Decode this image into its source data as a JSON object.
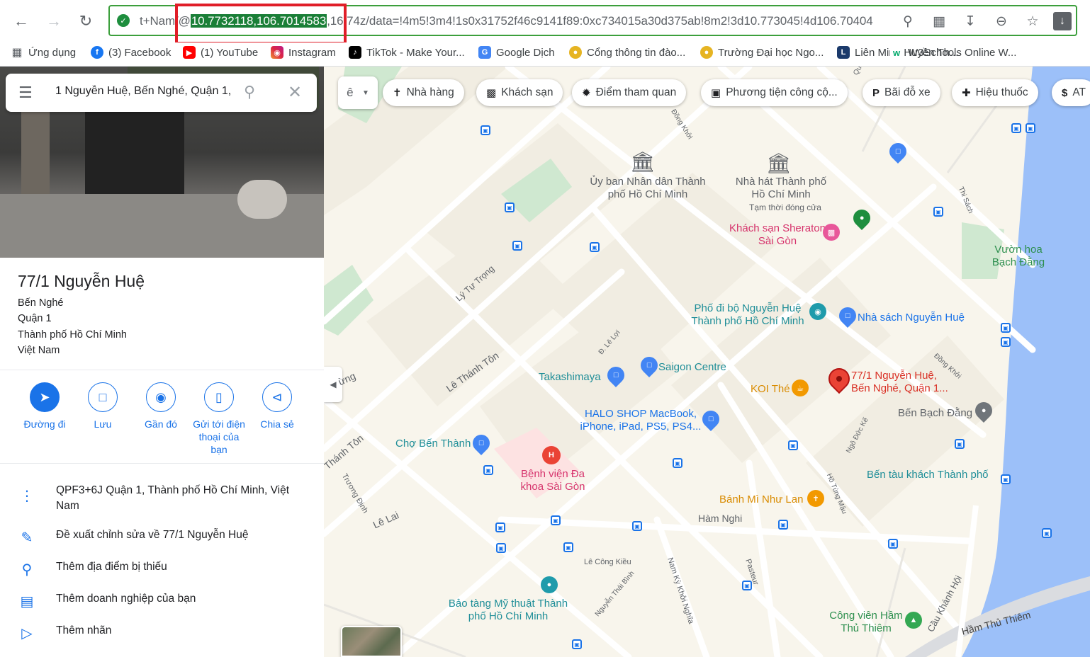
{
  "browser": {
    "url_prefix": "t+Nam/@",
    "url_highlight": "10.7732118,106.7014583",
    "url_suffix": ",16.74z/data=!4m5!3m4!1s0x31752f46c9141f89:0xc734015a30d375ab!8m2!3d10.773045!4d106.70404"
  },
  "bookmarks": [
    {
      "label": "Ứng dụng"
    },
    {
      "label": "(3) Facebook"
    },
    {
      "label": "(1) YouTube"
    },
    {
      "label": "Instagram"
    },
    {
      "label": "TikTok - Make Your..."
    },
    {
      "label": "Google Dịch"
    },
    {
      "label": "Cổng thông tin đào..."
    },
    {
      "label": "Trường Đại học Ngo..."
    },
    {
      "label": "Liên Minh Huyền Th..."
    },
    {
      "label": "W3Schools Online W..."
    }
  ],
  "search": {
    "value": "1 Nguyễn Huệ, Bến Nghé, Quận 1,"
  },
  "place": {
    "title": "77/1 Nguyễn Huệ",
    "address": [
      "Bến Nghé",
      "Quận 1",
      "Thành phố Hồ Chí Minh",
      "Việt Nam"
    ]
  },
  "actions": [
    {
      "label": "Đường đi"
    },
    {
      "label": "Lưu"
    },
    {
      "label": "Gần đó"
    },
    {
      "label": "Gửi tới điện thoại của bạn"
    },
    {
      "label": "Chia sẻ"
    }
  ],
  "info_rows": [
    {
      "text": "QPF3+6J Quận 1, Thành phố Hồ Chí Minh, Việt Nam"
    },
    {
      "text": "Đề xuất chỉnh sửa về 77/1 Nguyễn Huệ"
    },
    {
      "text": "Thêm địa điểm bị thiếu"
    },
    {
      "text": "Thêm doanh nghiệp của bạn"
    },
    {
      "text": "Thêm nhãn"
    }
  ],
  "map": {
    "lang_glyph": "ê",
    "chips": [
      {
        "label": "Nhà hàng"
      },
      {
        "label": "Khách sạn"
      },
      {
        "label": "Điểm tham quan"
      },
      {
        "label": "Phương tiện công cộ..."
      },
      {
        "label": "Bãi đỗ xe"
      },
      {
        "label": "Hiệu thuốc"
      },
      {
        "label": "AT"
      }
    ],
    "places": {
      "ubnd": "Ủy ban Nhân dân Thành phố Hồ Chí Minh",
      "nhahat": "Nhà hát Thành phố Hồ Chí Minh",
      "nhahat_sub": "Tạm thời đóng cửa",
      "sheraton": "Khách sạn Sheraton Sài Gòn",
      "vuonhoa": "Vườn hoa Bạch Đằng",
      "phodibo": "Phố đi bộ Nguyễn Huệ Thành phố Hồ Chí Minh",
      "nhasach": "Nhà sách Nguyễn Huệ",
      "takashimaya": "Takashimaya",
      "saigoncentre": "Saigon Centre",
      "koi": "KOI Thé",
      "pin_label": "77/1 Nguyễn Huệ, Bến Nghé, Quận 1...",
      "halo": "HALO SHOP MacBook, iPhone, iPad, PS5, PS4...",
      "benbachdang": "Bến Bạch Đằng",
      "chobenthanh": "Chợ Bến Thành",
      "benhvien": "Bệnh viện Đa khoa Sài Gòn",
      "bentau": "Bến tàu khách Thành phố",
      "banhmi": "Bánh Mì Như Lan",
      "baotang": "Bảo tàng Mỹ thuật Thành phố Hồ Chí Minh",
      "congvien": "Công viên Hầm Thủ Thiêm"
    },
    "streets": {
      "lytutrong": "Lý Tự Trọng",
      "lethanhton": "Lê Thánh Tôn",
      "lethanhton2": "Thánh Tôn",
      "dleloi": "Đ. Lê Lợi",
      "lelai": "Lê Lai",
      "truongdinh": "Trương Định",
      "hamnghi": "Hàm Nghi",
      "lecongkieu": "Lê Công Kiều",
      "nguyenthaibinh": "Nguyễn Thái Bình",
      "namkykhoinghia": "Nam Kỳ Khởi Nghĩa",
      "pasteur": "Pasteur",
      "hotungmau": "Hồ Tùng Mậu",
      "ngoducke": "Ngô Đức Kế",
      "dongkhoi": "Đồng Khởi",
      "thisach": "Thi Sách",
      "caukhanhhoi": "Cầu Khánh Hội",
      "hamthuthiem": "Hầm Thủ Thiêm",
      "dongkhoi2": "Đồng Khởi",
      "dung": "ừng",
      "quoc": "Quố"
    }
  }
}
